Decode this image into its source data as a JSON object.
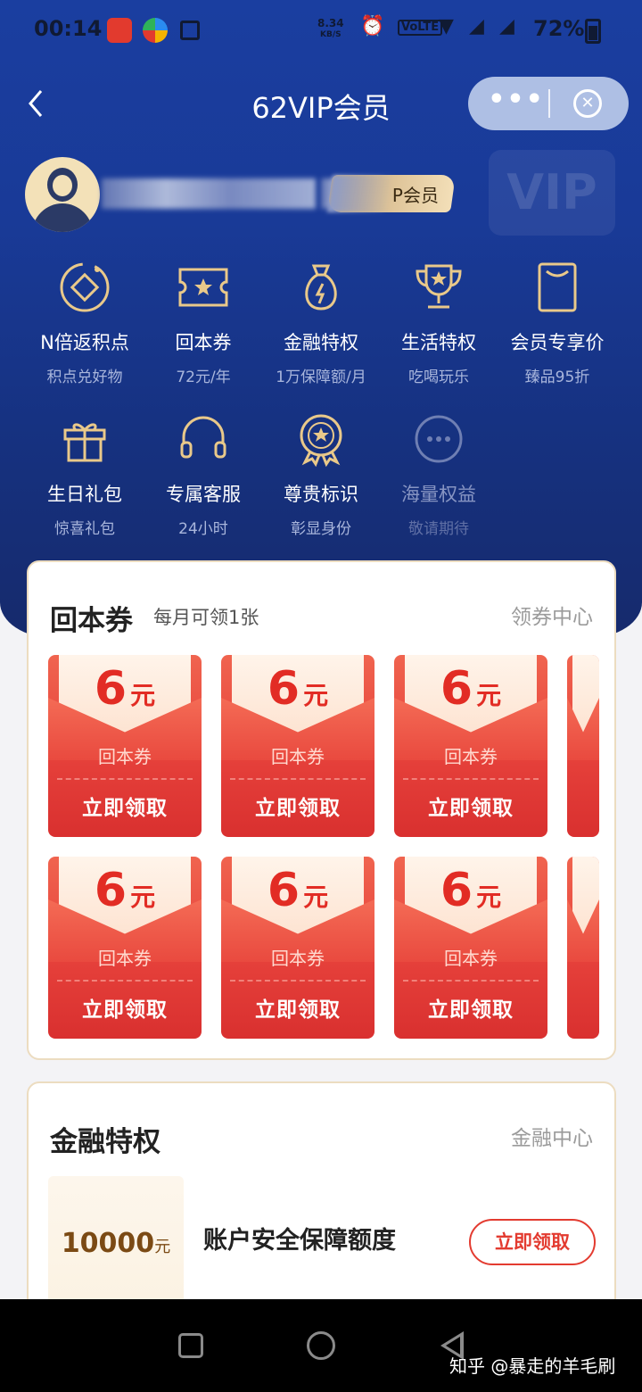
{
  "status_bar": {
    "time": "00:14",
    "speed_value": "8.34",
    "speed_unit": "KB/S",
    "battery": "72%"
  },
  "nav": {
    "title": "62VIP会员",
    "more_icon": "more-dots-icon",
    "close_icon": "close-circle-icon"
  },
  "profile": {
    "vip_tag": "P会员",
    "watermark": "VIP"
  },
  "benefits": [
    {
      "label": "N倍返积点",
      "sub": "积点兑好物",
      "icon": "coin-diamond-icon"
    },
    {
      "label": "回本券",
      "sub": "72元/年",
      "icon": "ticket-star-icon"
    },
    {
      "label": "金融特权",
      "sub": "1万保障额/月",
      "icon": "money-bag-icon"
    },
    {
      "label": "生活特权",
      "sub": "吃喝玩乐",
      "icon": "trophy-icon"
    },
    {
      "label": "会员专享价",
      "sub": "臻品95折",
      "icon": "tag-card-icon"
    },
    {
      "label": "生日礼包",
      "sub": "惊喜礼包",
      "icon": "gift-box-icon"
    },
    {
      "label": "专属客服",
      "sub": "24小时",
      "icon": "headset-icon"
    },
    {
      "label": "尊贵标识",
      "sub": "彰显身份",
      "icon": "medal-icon"
    },
    {
      "label": "海量权益",
      "sub": "敬请期待",
      "icon": "more-circle-icon"
    }
  ],
  "coupon_section": {
    "title": "回本券",
    "subtitle": "每月可领1张",
    "link": "领券中心",
    "coupons": [
      {
        "amount": "6",
        "unit": "元",
        "kind": "回本券",
        "button": "立即领取"
      },
      {
        "amount": "6",
        "unit": "元",
        "kind": "回本券",
        "button": "立即领取"
      },
      {
        "amount": "6",
        "unit": "元",
        "kind": "回本券",
        "button": "立即领取"
      },
      {
        "amount": "6",
        "unit": "元",
        "kind": "回本券",
        "button": "立即领取"
      },
      {
        "amount": "6",
        "unit": "元",
        "kind": "回本券",
        "button": "立即领取"
      },
      {
        "amount": "6",
        "unit": "元",
        "kind": "回本券",
        "button": "立即领取"
      }
    ]
  },
  "finance_section": {
    "title": "金融特权",
    "link": "金融中心",
    "amount": "10000",
    "unit": "元",
    "description": "账户安全保障额度",
    "button": "立即领取"
  },
  "watermark": "知乎 @暴走的羊毛刷",
  "colors": {
    "hero_blue": "#1a3ea0",
    "gold": "#e9c98a",
    "coupon_red": "#e6413b"
  }
}
